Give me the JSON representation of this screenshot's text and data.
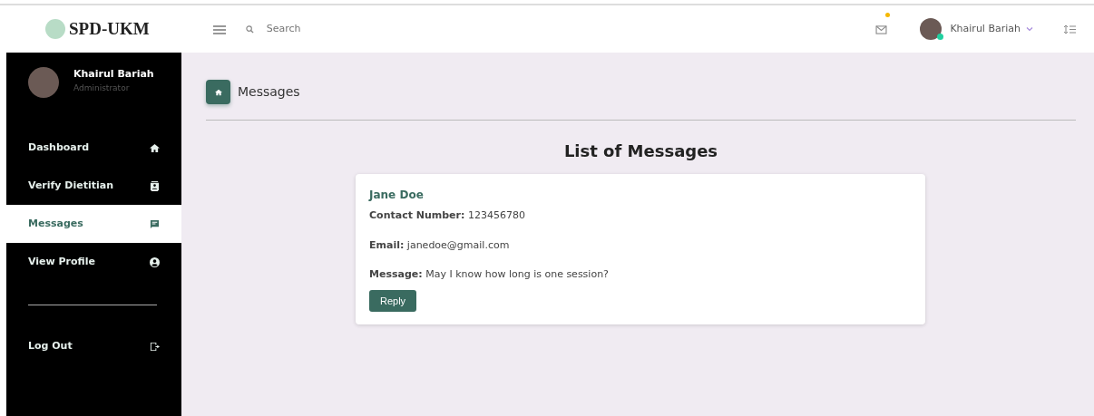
{
  "brand": {
    "name": "SPD-UKM"
  },
  "topbar": {
    "search_placeholder": "Search",
    "mail_unread": true,
    "user_name": "Khairul Bariah",
    "user_online": true
  },
  "sidebar": {
    "profile": {
      "name": "Khairul Bariah",
      "role": "Administrator"
    },
    "items": [
      {
        "label": "Dashboard",
        "selected": false
      },
      {
        "label": "Verify Dietitian",
        "selected": false
      },
      {
        "label": "Messages",
        "selected": true
      },
      {
        "label": "View Profile",
        "selected": false
      }
    ],
    "footer_items": [
      {
        "label": "Log Out",
        "selected": false
      }
    ]
  },
  "page": {
    "breadcrumb": "Messages",
    "heading": "List of Messages"
  },
  "messages": [
    {
      "name": "Jane Doe",
      "fields": [
        "**Contact Number:** 123456780",
        "**Email:** janedoe@gmail.com",
        "**Message:** May I know how long is one session?"
      ],
      "action": "Reply"
    }
  ]
}
